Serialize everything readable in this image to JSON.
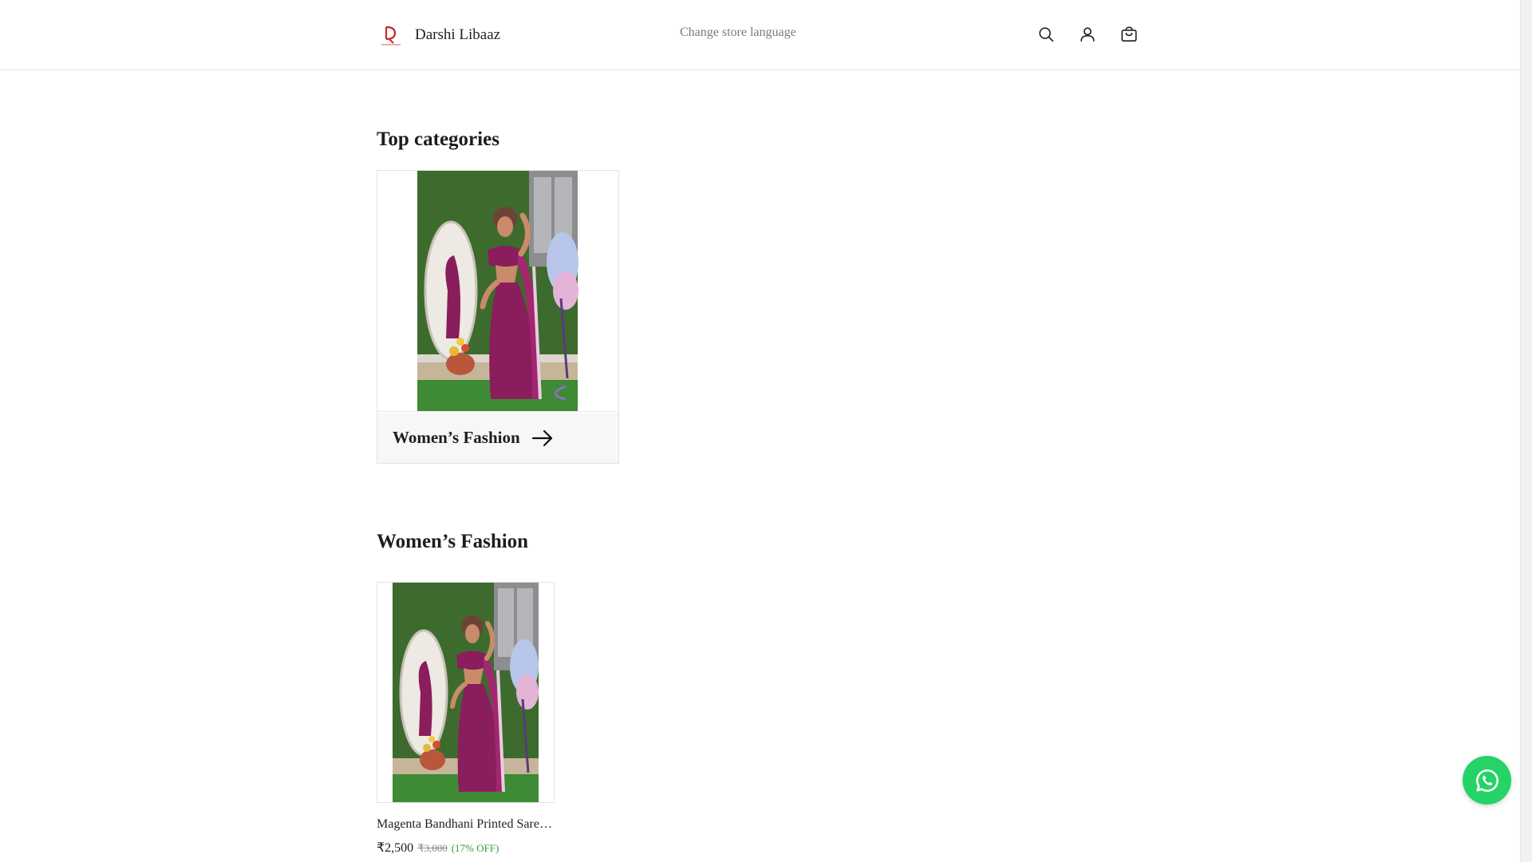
{
  "header": {
    "brand_name": "Darshi Libaaz",
    "language_link": "Change store language",
    "icons": [
      "search-icon",
      "user-icon",
      "shopping-bag-icon"
    ]
  },
  "sections": {
    "top_categories_title": "Top categories",
    "category": {
      "label": "Women’s Fashion",
      "icon": "arrow-right-icon"
    },
    "collection_title": "Women’s Fashion"
  },
  "product": {
    "name": "Magenta Bandhani Printed Saree with Blouse",
    "price": "₹2,500",
    "mrp": "₹3,000",
    "discount": "(17% OFF)"
  },
  "whatsapp": {
    "icon": "whatsapp-icon"
  },
  "colors": {
    "brand_red": "#c62828",
    "discount_green": "#2e9d3e",
    "whatsapp_green": "#25d366",
    "saree_magenta": "#8a1d5c",
    "grass_green": "#3d6b2e"
  }
}
